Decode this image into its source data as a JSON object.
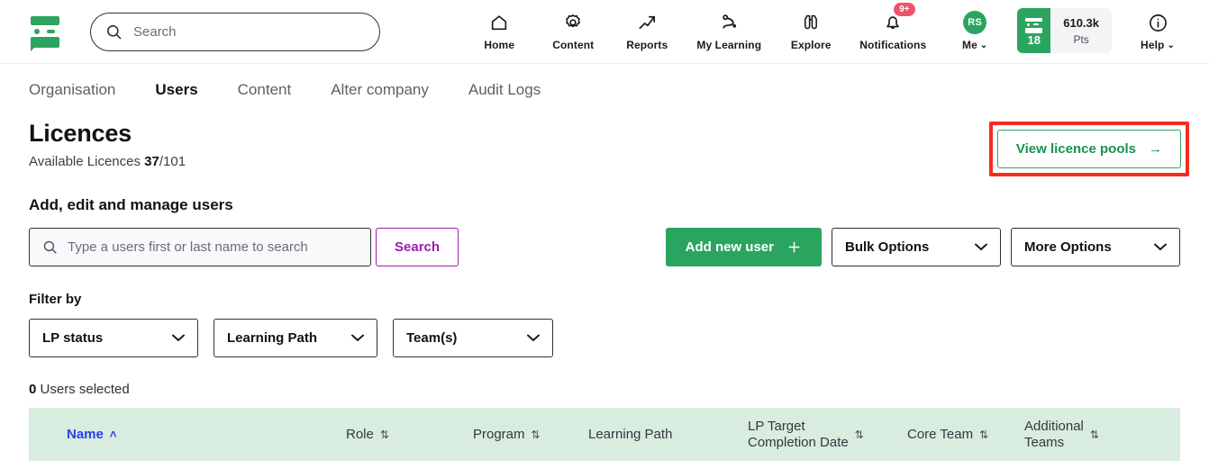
{
  "header": {
    "logo_name": "brand-logo",
    "search": {
      "placeholder": "Search",
      "icon": "search-icon"
    },
    "nav": [
      {
        "label": "Home",
        "icon": "home-icon"
      },
      {
        "label": "Content",
        "icon": "gear-icon"
      },
      {
        "label": "Reports",
        "icon": "trending-arrow-icon"
      },
      {
        "label": "My Learning",
        "icon": "path-pin-icon"
      },
      {
        "label": "Explore",
        "icon": "binoculars-icon"
      },
      {
        "label": "Notifications",
        "icon": "bell-icon",
        "badge": "9+"
      },
      {
        "label": "Me",
        "icon": "avatar-icon",
        "avatar_initials": "RS",
        "caret": "⌄"
      },
      {
        "label": "Help",
        "icon": "info-circle-icon",
        "caret": "⌄"
      }
    ],
    "points": {
      "count": "18",
      "value": "610.3k",
      "unit": "Pts"
    }
  },
  "tabs": [
    {
      "label": "Organisation",
      "active": false
    },
    {
      "label": "Users",
      "active": true
    },
    {
      "label": "Content",
      "active": false
    },
    {
      "label": "Alter company",
      "active": false
    },
    {
      "label": "Audit Logs",
      "active": false
    }
  ],
  "licences": {
    "title": "Licences",
    "subtitle_prefix": "Available Licences",
    "available": "37",
    "total": "/101",
    "pools_button": "View licence pools",
    "pools_arrow": "→"
  },
  "manage": {
    "heading": "Add, edit and manage users",
    "search_placeholder": "Type a users first or last name to search",
    "search_button": "Search",
    "add_user_button": "Add new user",
    "add_user_plus": "+",
    "bulk_options": "Bulk Options",
    "more_options": "More Options",
    "chevron": "⌄"
  },
  "filter": {
    "heading": "Filter by",
    "dropdowns": [
      {
        "label": "LP status"
      },
      {
        "label": "Learning Path"
      },
      {
        "label": "Team(s)"
      }
    ]
  },
  "table": {
    "selected_count": "0",
    "selected_text": "Users selected",
    "columns": [
      {
        "label": "Name",
        "sort": "˄",
        "sorted": true
      },
      {
        "label": "Role",
        "sort": "⇅"
      },
      {
        "label": "Program",
        "sort": "⇅"
      },
      {
        "label": "Learning Path",
        "sort": ""
      },
      {
        "label": "LP Target",
        "label2": "Completion Date",
        "sort": "⇅"
      },
      {
        "label": "Core Team",
        "sort": "⇅"
      },
      {
        "label": "Additional",
        "label2": "Teams",
        "sort": "⇅"
      }
    ]
  },
  "colors": {
    "brand_green": "#2ba45f",
    "table_header_green": "#d8ecdf",
    "search_purple": "#a11bb0",
    "sort_blue": "#2a3ef0",
    "annotation_red": "#f62c1f",
    "badge_red": "#ef5369"
  }
}
